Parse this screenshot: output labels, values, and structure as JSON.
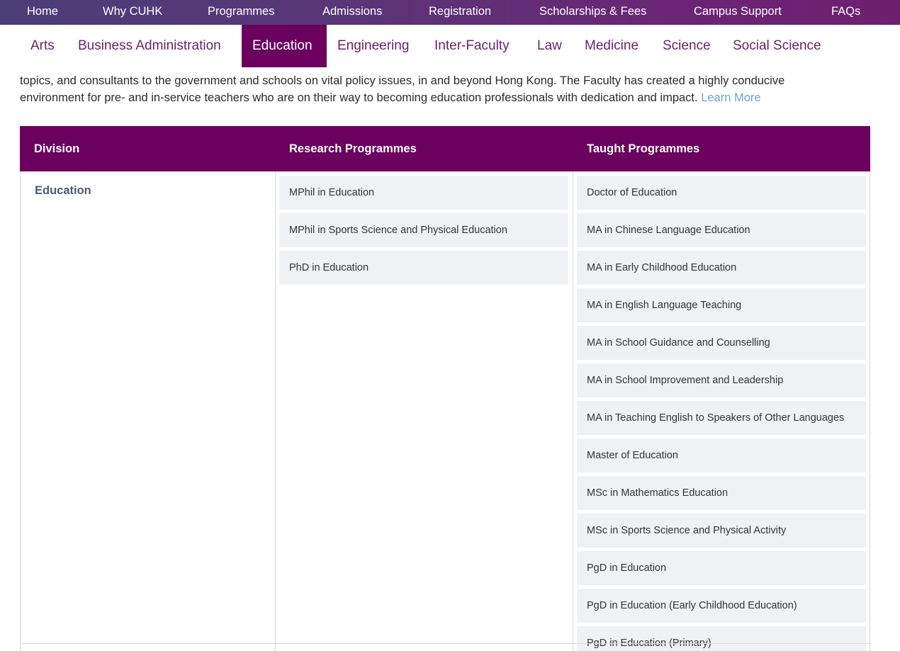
{
  "top_nav": {
    "items": [
      "Home",
      "Why CUHK",
      "Programmes",
      "Admissions",
      "Registration",
      "Scholarships & Fees",
      "Campus Support",
      "FAQs"
    ]
  },
  "faculty_tabs": {
    "items": [
      "Arts",
      "Business Administration",
      "Education",
      "Engineering",
      "Inter-Faculty",
      "Law",
      "Medicine",
      "Science",
      "Social Science"
    ],
    "active": "Education"
  },
  "intro": {
    "line2": "topics, and consultants to the government and schools on vital policy issues, in and beyond Hong Kong.  The Faculty has created a highly conducive",
    "line3": "environment for pre- and in-service teachers who are on their way to becoming education professionals with dedication and impact.",
    "learn_more": "Learn More"
  },
  "table": {
    "headers": {
      "division": "Division",
      "research": "Research Programmes",
      "taught": "Taught Programmes"
    },
    "division": "Education",
    "research_programmes": [
      "MPhil in Education",
      "MPhil in Sports Science and Physical Education",
      "PhD in Education"
    ],
    "taught_programmes": [
      "Doctor of Education",
      "MA in Chinese Language Education",
      "MA in Early Childhood Education",
      "MA in English Language Teaching",
      "MA in School Guidance and Counselling",
      "MA in School Improvement and Leadership",
      "MA in Teaching English to Speakers of Other Languages",
      "Master of Education",
      "MSc in Mathematics Education",
      "MSc in Sports Science and Physical Activity",
      "PgD in Education",
      "PgD in Education (Early Childhood Education)",
      "PgD in Education (Primary)"
    ]
  },
  "colors": {
    "nav_gradient_start": "#4b3e78",
    "nav_gradient_end": "#6f1f70",
    "brand_purple": "#6b005f",
    "tab_text": "#6d1f6d",
    "link": "#6aa5d6",
    "division_text": "#4a5a78",
    "cell_bg": "#f0f1f4"
  }
}
